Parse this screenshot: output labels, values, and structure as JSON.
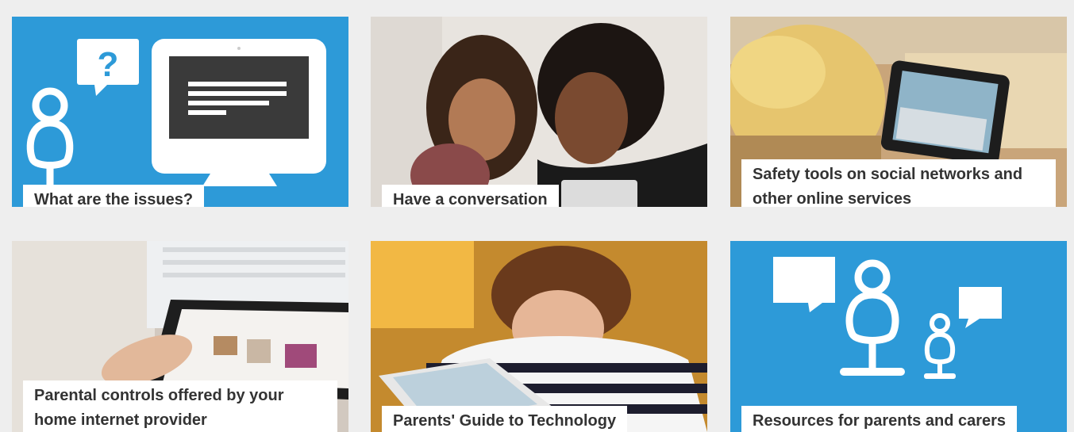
{
  "colors": {
    "brand_blue": "#2d9ad8",
    "caption_bg": "#ffffff",
    "caption_text": "#333333",
    "page_bg": "#eeeeee"
  },
  "tiles": [
    {
      "label": "What are the issues?",
      "image": "illustration-person-question-monitor"
    },
    {
      "label": "Have a conversation",
      "image": "photo-mother-daughter-laptop"
    },
    {
      "label": "Safety tools on social networks and other online services",
      "image": "photo-child-using-tablet"
    },
    {
      "label": "Parental controls offered by your home internet provider",
      "image": "photo-hands-on-tablet"
    },
    {
      "label": "Parents' Guide to Technology",
      "image": "photo-boy-with-tablet"
    },
    {
      "label": "Resources for parents and carers",
      "image": "illustration-parent-child-speech-bubbles"
    }
  ]
}
